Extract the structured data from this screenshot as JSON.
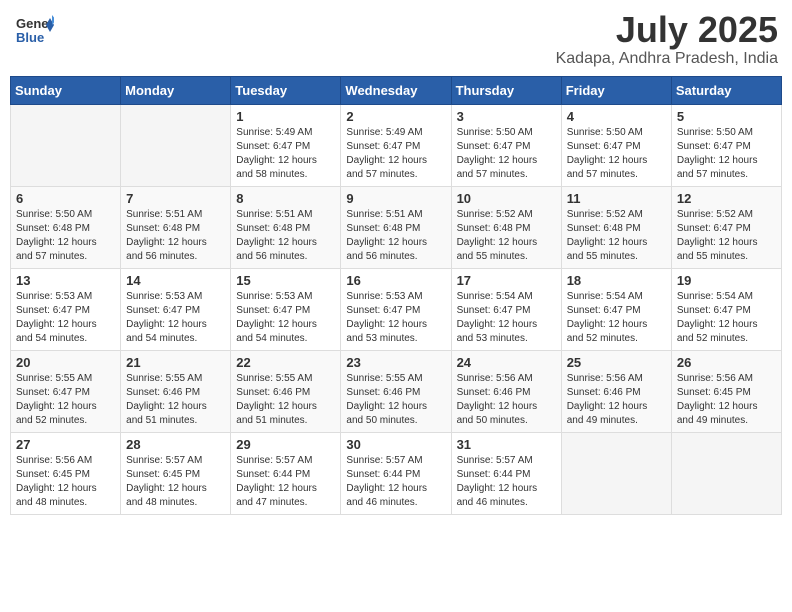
{
  "header": {
    "logo_general": "General",
    "logo_blue": "Blue",
    "month_year": "July 2025",
    "location": "Kadapa, Andhra Pradesh, India"
  },
  "weekdays": [
    "Sunday",
    "Monday",
    "Tuesday",
    "Wednesday",
    "Thursday",
    "Friday",
    "Saturday"
  ],
  "weeks": [
    [
      {
        "day": "",
        "info": ""
      },
      {
        "day": "",
        "info": ""
      },
      {
        "day": "1",
        "info": "Sunrise: 5:49 AM\nSunset: 6:47 PM\nDaylight: 12 hours\nand 58 minutes."
      },
      {
        "day": "2",
        "info": "Sunrise: 5:49 AM\nSunset: 6:47 PM\nDaylight: 12 hours\nand 57 minutes."
      },
      {
        "day": "3",
        "info": "Sunrise: 5:50 AM\nSunset: 6:47 PM\nDaylight: 12 hours\nand 57 minutes."
      },
      {
        "day": "4",
        "info": "Sunrise: 5:50 AM\nSunset: 6:47 PM\nDaylight: 12 hours\nand 57 minutes."
      },
      {
        "day": "5",
        "info": "Sunrise: 5:50 AM\nSunset: 6:47 PM\nDaylight: 12 hours\nand 57 minutes."
      }
    ],
    [
      {
        "day": "6",
        "info": "Sunrise: 5:50 AM\nSunset: 6:48 PM\nDaylight: 12 hours\nand 57 minutes."
      },
      {
        "day": "7",
        "info": "Sunrise: 5:51 AM\nSunset: 6:48 PM\nDaylight: 12 hours\nand 56 minutes."
      },
      {
        "day": "8",
        "info": "Sunrise: 5:51 AM\nSunset: 6:48 PM\nDaylight: 12 hours\nand 56 minutes."
      },
      {
        "day": "9",
        "info": "Sunrise: 5:51 AM\nSunset: 6:48 PM\nDaylight: 12 hours\nand 56 minutes."
      },
      {
        "day": "10",
        "info": "Sunrise: 5:52 AM\nSunset: 6:48 PM\nDaylight: 12 hours\nand 55 minutes."
      },
      {
        "day": "11",
        "info": "Sunrise: 5:52 AM\nSunset: 6:48 PM\nDaylight: 12 hours\nand 55 minutes."
      },
      {
        "day": "12",
        "info": "Sunrise: 5:52 AM\nSunset: 6:47 PM\nDaylight: 12 hours\nand 55 minutes."
      }
    ],
    [
      {
        "day": "13",
        "info": "Sunrise: 5:53 AM\nSunset: 6:47 PM\nDaylight: 12 hours\nand 54 minutes."
      },
      {
        "day": "14",
        "info": "Sunrise: 5:53 AM\nSunset: 6:47 PM\nDaylight: 12 hours\nand 54 minutes."
      },
      {
        "day": "15",
        "info": "Sunrise: 5:53 AM\nSunset: 6:47 PM\nDaylight: 12 hours\nand 54 minutes."
      },
      {
        "day": "16",
        "info": "Sunrise: 5:53 AM\nSunset: 6:47 PM\nDaylight: 12 hours\nand 53 minutes."
      },
      {
        "day": "17",
        "info": "Sunrise: 5:54 AM\nSunset: 6:47 PM\nDaylight: 12 hours\nand 53 minutes."
      },
      {
        "day": "18",
        "info": "Sunrise: 5:54 AM\nSunset: 6:47 PM\nDaylight: 12 hours\nand 52 minutes."
      },
      {
        "day": "19",
        "info": "Sunrise: 5:54 AM\nSunset: 6:47 PM\nDaylight: 12 hours\nand 52 minutes."
      }
    ],
    [
      {
        "day": "20",
        "info": "Sunrise: 5:55 AM\nSunset: 6:47 PM\nDaylight: 12 hours\nand 52 minutes."
      },
      {
        "day": "21",
        "info": "Sunrise: 5:55 AM\nSunset: 6:46 PM\nDaylight: 12 hours\nand 51 minutes."
      },
      {
        "day": "22",
        "info": "Sunrise: 5:55 AM\nSunset: 6:46 PM\nDaylight: 12 hours\nand 51 minutes."
      },
      {
        "day": "23",
        "info": "Sunrise: 5:55 AM\nSunset: 6:46 PM\nDaylight: 12 hours\nand 50 minutes."
      },
      {
        "day": "24",
        "info": "Sunrise: 5:56 AM\nSunset: 6:46 PM\nDaylight: 12 hours\nand 50 minutes."
      },
      {
        "day": "25",
        "info": "Sunrise: 5:56 AM\nSunset: 6:46 PM\nDaylight: 12 hours\nand 49 minutes."
      },
      {
        "day": "26",
        "info": "Sunrise: 5:56 AM\nSunset: 6:45 PM\nDaylight: 12 hours\nand 49 minutes."
      }
    ],
    [
      {
        "day": "27",
        "info": "Sunrise: 5:56 AM\nSunset: 6:45 PM\nDaylight: 12 hours\nand 48 minutes."
      },
      {
        "day": "28",
        "info": "Sunrise: 5:57 AM\nSunset: 6:45 PM\nDaylight: 12 hours\nand 48 minutes."
      },
      {
        "day": "29",
        "info": "Sunrise: 5:57 AM\nSunset: 6:44 PM\nDaylight: 12 hours\nand 47 minutes."
      },
      {
        "day": "30",
        "info": "Sunrise: 5:57 AM\nSunset: 6:44 PM\nDaylight: 12 hours\nand 46 minutes."
      },
      {
        "day": "31",
        "info": "Sunrise: 5:57 AM\nSunset: 6:44 PM\nDaylight: 12 hours\nand 46 minutes."
      },
      {
        "day": "",
        "info": ""
      },
      {
        "day": "",
        "info": ""
      }
    ]
  ]
}
